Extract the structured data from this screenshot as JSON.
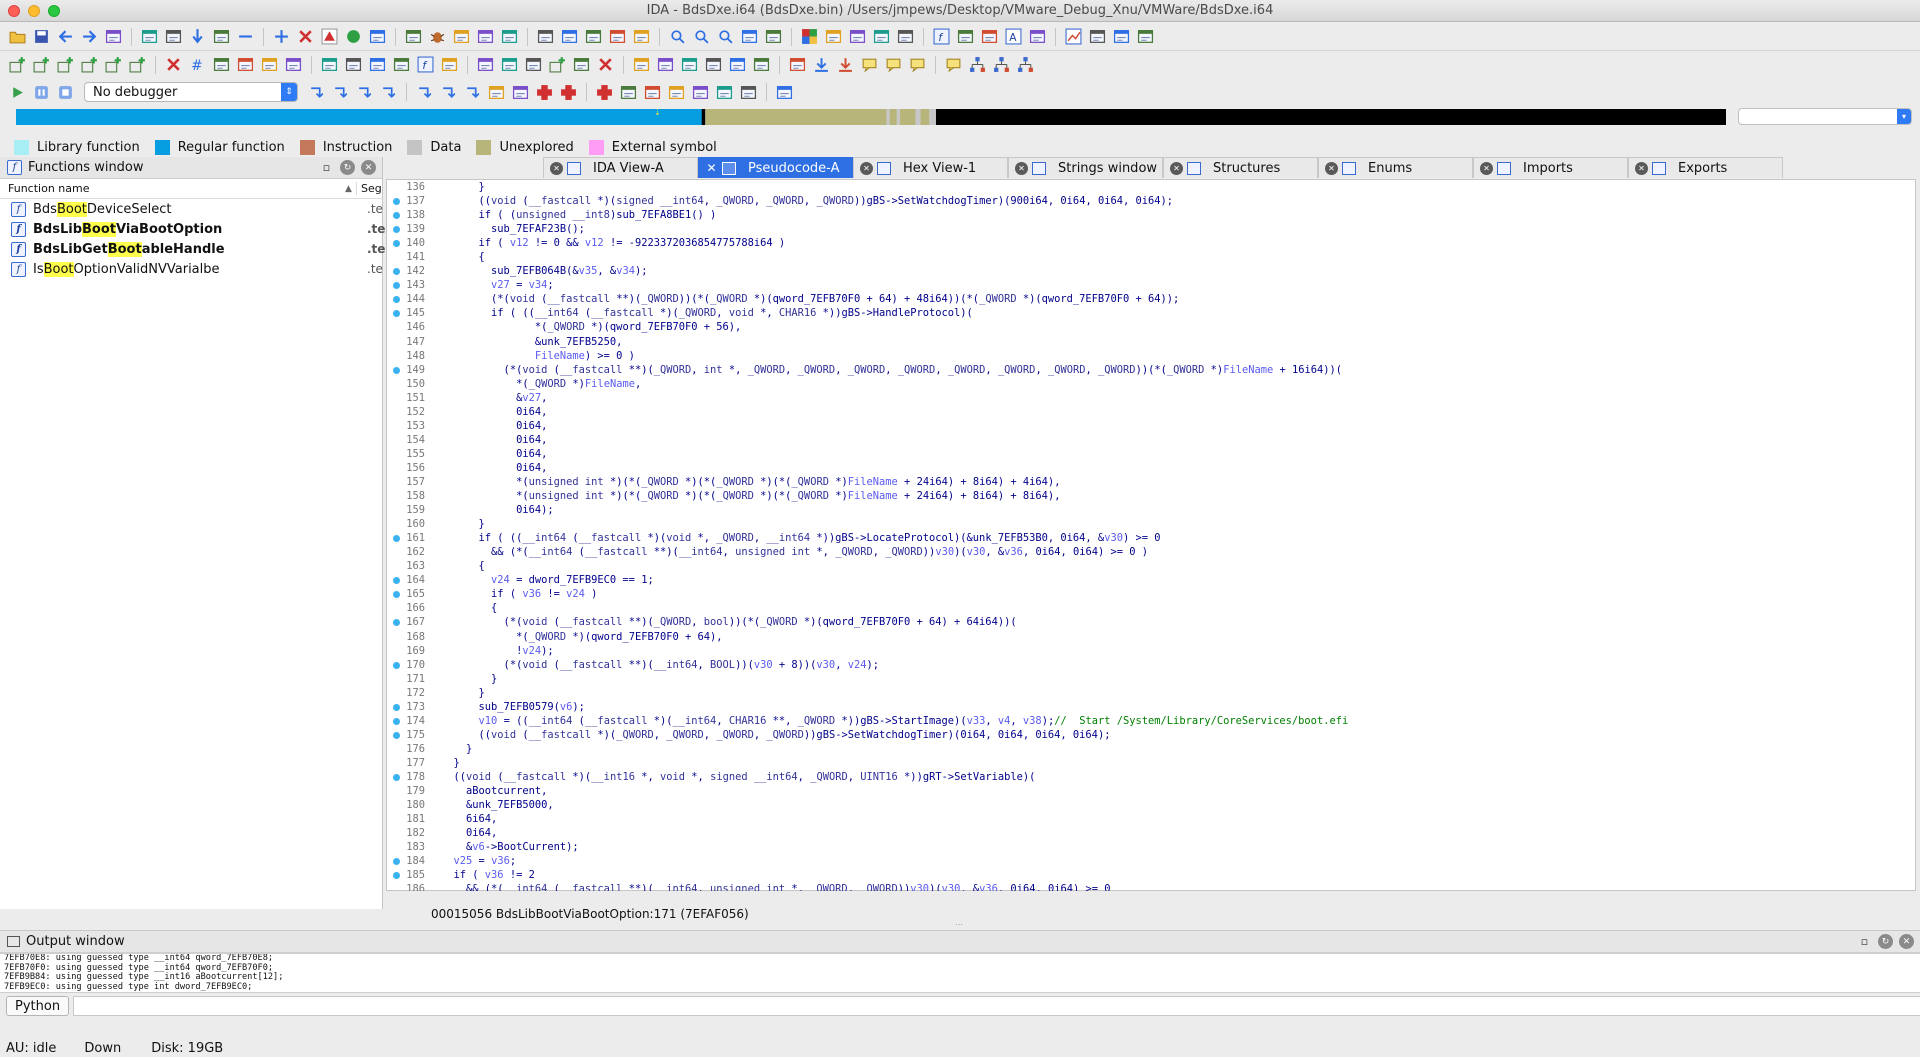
{
  "window": {
    "title": "IDA - BdsDxe.i64 (BdsDxe.bin) /Users/jmpews/Desktop/VMware_Debug_Xnu/VMWare/BdsDxe.i64"
  },
  "toolbar": {
    "debugger_select": "No debugger",
    "row1_icons": [
      "open-icon",
      "save-icon",
      "back-icon",
      "forward-icon",
      "binary-icon",
      "binary-icon",
      "binary-icon",
      "jump-icon",
      "pencil-icon",
      "minus-icon",
      "plus-icon",
      "delete-icon",
      "triangle-icon",
      "run-circle-icon",
      "window-icon",
      "window-icon",
      "bug-icon",
      "window-icon",
      "grid-icon",
      "window-icon",
      "window-icon",
      "window-icon",
      "window-icon",
      "window-icon",
      "window-icon",
      "search-icon",
      "search-icon",
      "search-icon",
      "print-icon",
      "edit-icon",
      "color-icon",
      "window-icon",
      "window-icon",
      "window-icon",
      "window-icon",
      "function-icon",
      "window-icon",
      "window-icon",
      "text-icon",
      "list-icon",
      "graph-icon",
      "struct-icon",
      "window-icon",
      "window-icon"
    ],
    "row2_icons": [
      "add-icon",
      "add-icon",
      "add-icon",
      "add-icon",
      "add-icon",
      "add-icon",
      "delete-icon",
      "hash-icon",
      "window-icon",
      "window-icon",
      "window-icon",
      "edit-icon",
      "document-icon",
      "window-icon",
      "window-icon",
      "window-icon",
      "function-icon",
      "window-icon",
      "window-icon",
      "window-icon",
      "window-icon",
      "add-icon",
      "window-icon",
      "delete-icon",
      "window-icon",
      "window-icon",
      "window-icon",
      "window-icon",
      "window-icon",
      "window-icon",
      "window-icon",
      "download-icon",
      "upload-icon",
      "comment-icon",
      "comment-icon",
      "comment-icon",
      "comment-icon",
      "tree-icon",
      "tree-icon",
      "tree-icon"
    ],
    "row3_icons": [
      "play-icon",
      "pause-icon",
      "stop-icon",
      "step-icon",
      "step-icon",
      "step-icon",
      "step-icon",
      "step-icon",
      "step-icon",
      "step-icon",
      "window-icon",
      "window-icon",
      "breakpoint-icon",
      "breakpoint-icon",
      "breakpoint-icon",
      "window-icon",
      "window-icon",
      "window-icon",
      "window-icon",
      "window-icon",
      "window-icon",
      "window-icon"
    ]
  },
  "navband": {
    "segments": [
      {
        "w": 0.401,
        "color": "#069ee0"
      },
      {
        "w": 0.002,
        "color": "#000000"
      },
      {
        "w": 0.106,
        "color": "#b8b57a"
      },
      {
        "w": 0.002,
        "color": "#c7c7c7"
      },
      {
        "w": 0.004,
        "color": "#b8b57a"
      },
      {
        "w": 0.002,
        "color": "#c7c7c7"
      },
      {
        "w": 0.009,
        "color": "#b8b57a"
      },
      {
        "w": 0.003,
        "color": "#c7c7c7"
      },
      {
        "w": 0.005,
        "color": "#b8b57a"
      },
      {
        "w": 0.004,
        "color": "#c7c7c7"
      },
      {
        "w": 0.462,
        "color": "#000000"
      }
    ],
    "marker": "⇣"
  },
  "legend": {
    "items": [
      {
        "label": "Library function",
        "color": "#a8eef5"
      },
      {
        "label": "Regular function",
        "color": "#069ee0"
      },
      {
        "label": "Instruction",
        "color": "#c47a5a"
      },
      {
        "label": "Data",
        "color": "#c4c4c4"
      },
      {
        "label": "Unexplored",
        "color": "#b8b57a"
      },
      {
        "label": "External symbol",
        "color": "#ff9cf5"
      }
    ]
  },
  "functions_window": {
    "title": "Functions window",
    "columns": [
      "Function name",
      "Seg"
    ],
    "rows": [
      {
        "pre": "Bds",
        "hl": "Boot",
        "post": "DeviceSelect",
        "seg": ".te",
        "bold": false
      },
      {
        "pre": "BdsLib",
        "hl": "Boot",
        "post": "ViaBootOption",
        "seg": ".te",
        "bold": true
      },
      {
        "pre": "BdsLibGet",
        "hl": "Boot",
        "post": "ableHandle",
        "seg": ".te",
        "bold": true
      },
      {
        "pre": "Is",
        "hl": "Boot",
        "post": "OptionValidNVVarialbe",
        "seg": ".te",
        "bold": false
      }
    ],
    "filter_value": "boot"
  },
  "tabs": [
    {
      "label": "IDA View-A",
      "active": false
    },
    {
      "label": "Pseudocode-A",
      "active": true
    },
    {
      "label": "Hex View-1",
      "active": false
    },
    {
      "label": "Strings window",
      "active": false
    },
    {
      "label": "Structures",
      "active": false
    },
    {
      "label": "Enums",
      "active": false
    },
    {
      "label": "Imports",
      "active": false
    },
    {
      "label": "Exports",
      "active": false
    }
  ],
  "code": {
    "lines": [
      {
        "n": "136",
        "bp": false,
        "t": "      }"
      },
      {
        "n": "137",
        "bp": true,
        "t": "      ((void (__fastcall *)(signed __int64, _QWORD, _QWORD, _QWORD))gBS->SetWatchdogTimer)(900i64, 0i64, 0i64, 0i64);"
      },
      {
        "n": "138",
        "bp": true,
        "t": "      if ( (unsigned __int8)sub_7EFA8BE1() )"
      },
      {
        "n": "139",
        "bp": true,
        "t": "        sub_7EFAF23B();"
      },
      {
        "n": "140",
        "bp": true,
        "t": "      if ( v12 != 0 && v12 != -9223372036854775788i64 )"
      },
      {
        "n": "141",
        "bp": false,
        "t": "      {"
      },
      {
        "n": "142",
        "bp": true,
        "t": "        sub_7EFB064B(&v35, &v34);"
      },
      {
        "n": "143",
        "bp": true,
        "t": "        v27 = v34;"
      },
      {
        "n": "144",
        "bp": true,
        "t": "        (*(void (__fastcall **)(_QWORD))(*(_QWORD *)(qword_7EFB70F0 + 64) + 48i64))(*(_QWORD *)(qword_7EFB70F0 + 64));"
      },
      {
        "n": "145",
        "bp": true,
        "t": "        if ( ((__int64 (__fastcall *)(_QWORD, void *, CHAR16 *))gBS->HandleProtocol)("
      },
      {
        "n": "146",
        "bp": false,
        "t": "               *(_QWORD *)(qword_7EFB70F0 + 56),"
      },
      {
        "n": "147",
        "bp": false,
        "t": "               &unk_7EFB5250,"
      },
      {
        "n": "148",
        "bp": false,
        "t": "               FileName) >= 0 )"
      },
      {
        "n": "149",
        "bp": true,
        "t": "          (*(void (__fastcall **)(_QWORD, int *, _QWORD, _QWORD, _QWORD, _QWORD, _QWORD, _QWORD, _QWORD, _QWORD))(*(_QWORD *)FileName + 16i64))("
      },
      {
        "n": "150",
        "bp": false,
        "t": "            *(_QWORD *)FileName,"
      },
      {
        "n": "151",
        "bp": false,
        "t": "            &v27,"
      },
      {
        "n": "152",
        "bp": false,
        "t": "            0i64,"
      },
      {
        "n": "153",
        "bp": false,
        "t": "            0i64,"
      },
      {
        "n": "154",
        "bp": false,
        "t": "            0i64,"
      },
      {
        "n": "155",
        "bp": false,
        "t": "            0i64,"
      },
      {
        "n": "156",
        "bp": false,
        "t": "            0i64,"
      },
      {
        "n": "157",
        "bp": false,
        "t": "            *(unsigned int *)(*(_QWORD *)(*(_QWORD *)(*(_QWORD *)FileName + 24i64) + 8i64) + 4i64),"
      },
      {
        "n": "158",
        "bp": false,
        "t": "            *(unsigned int *)(*(_QWORD *)(*(_QWORD *)(*(_QWORD *)FileName + 24i64) + 8i64) + 8i64),"
      },
      {
        "n": "159",
        "bp": false,
        "t": "            0i64);"
      },
      {
        "n": "160",
        "bp": false,
        "t": "      }"
      },
      {
        "n": "161",
        "bp": true,
        "t": "      if ( ((__int64 (__fastcall *)(void *, _QWORD, __int64 *))gBS->LocateProtocol)(&unk_7EFB53B0, 0i64, &v30) >= 0"
      },
      {
        "n": "162",
        "bp": false,
        "t": "        && (*(__int64 (__fastcall **)(__int64, unsigned int *, _QWORD, _QWORD))v30)(v30, &v36, 0i64, 0i64) >= 0 )"
      },
      {
        "n": "163",
        "bp": false,
        "t": "      {"
      },
      {
        "n": "164",
        "bp": true,
        "t": "        v24 = dword_7EFB9EC0 == 1;"
      },
      {
        "n": "165",
        "bp": true,
        "t": "        if ( v36 != v24 )"
      },
      {
        "n": "166",
        "bp": false,
        "t": "        {"
      },
      {
        "n": "167",
        "bp": true,
        "t": "          (*(void (__fastcall **)(_QWORD, bool))(*(_QWORD *)(qword_7EFB70F0 + 64) + 64i64))("
      },
      {
        "n": "168",
        "bp": false,
        "t": "            *(_QWORD *)(qword_7EFB70F0 + 64),"
      },
      {
        "n": "169",
        "bp": false,
        "t": "            !v24);"
      },
      {
        "n": "170",
        "bp": true,
        "t": "          (*(void (__fastcall **)(__int64, BOOL))(v30 + 8))(v30, v24);"
      },
      {
        "n": "171",
        "bp": false,
        "t": "        }"
      },
      {
        "n": "172",
        "bp": false,
        "t": "      }"
      },
      {
        "n": "173",
        "bp": true,
        "t": "      sub_7EFB0579(v6);"
      },
      {
        "n": "174",
        "bp": true,
        "t": "      v10 = ((__int64 (__fastcall *)(__int64, CHAR16 **, _QWORD *))gBS->StartImage)(v33, v4, v38);//  Start /System/Library/CoreServices/boot.efi"
      },
      {
        "n": "175",
        "bp": true,
        "t": "      ((void (__fastcall *)(_QWORD, _QWORD, _QWORD, _QWORD))gBS->SetWatchdogTimer)(0i64, 0i64, 0i64, 0i64);"
      },
      {
        "n": "176",
        "bp": false,
        "t": "    }"
      },
      {
        "n": "177",
        "bp": false,
        "t": "  }"
      },
      {
        "n": "178",
        "bp": true,
        "t": "  ((void (__fastcall *)(__int16 *, void *, signed __int64, _QWORD, UINT16 *))gRT->SetVariable)("
      },
      {
        "n": "179",
        "bp": false,
        "t": "    aBootcurrent,"
      },
      {
        "n": "180",
        "bp": false,
        "t": "    &unk_7EFB5000,"
      },
      {
        "n": "181",
        "bp": false,
        "t": "    6i64,"
      },
      {
        "n": "182",
        "bp": false,
        "t": "    0i64,"
      },
      {
        "n": "183",
        "bp": false,
        "t": "    &v6->BootCurrent);"
      },
      {
        "n": "184",
        "bp": true,
        "t": "  v25 = v36;"
      },
      {
        "n": "185",
        "bp": true,
        "t": "  if ( v36 != 2"
      },
      {
        "n": "186",
        "bp": false,
        "t": "    && (*(__int64 (__fastcall **)(__int64, unsigned int *, _QWORD, _QWORD))v30)(v30, &v36, 0i64, 0i64) >= 0"
      }
    ],
    "status": "00015056  BdsLibBootViaBootOption:171 (7EFAF056)"
  },
  "output": {
    "title": "Output window",
    "lines": [
      "7EFB70E8: using guessed type __int64 qword_7EFB70E8;",
      "7EFB70F0: using guessed type __int64 qword_7EFB70F0;",
      "7EFB9B84: using guessed type __int16 aBootcurrent[12];",
      "7EFB9EC0: using guessed type int dword_7EFB9EC0;"
    ],
    "python_label": "Python"
  },
  "statusbar": {
    "au": "AU:  idle",
    "direction": "Down",
    "disk": "Disk: 19GB"
  }
}
